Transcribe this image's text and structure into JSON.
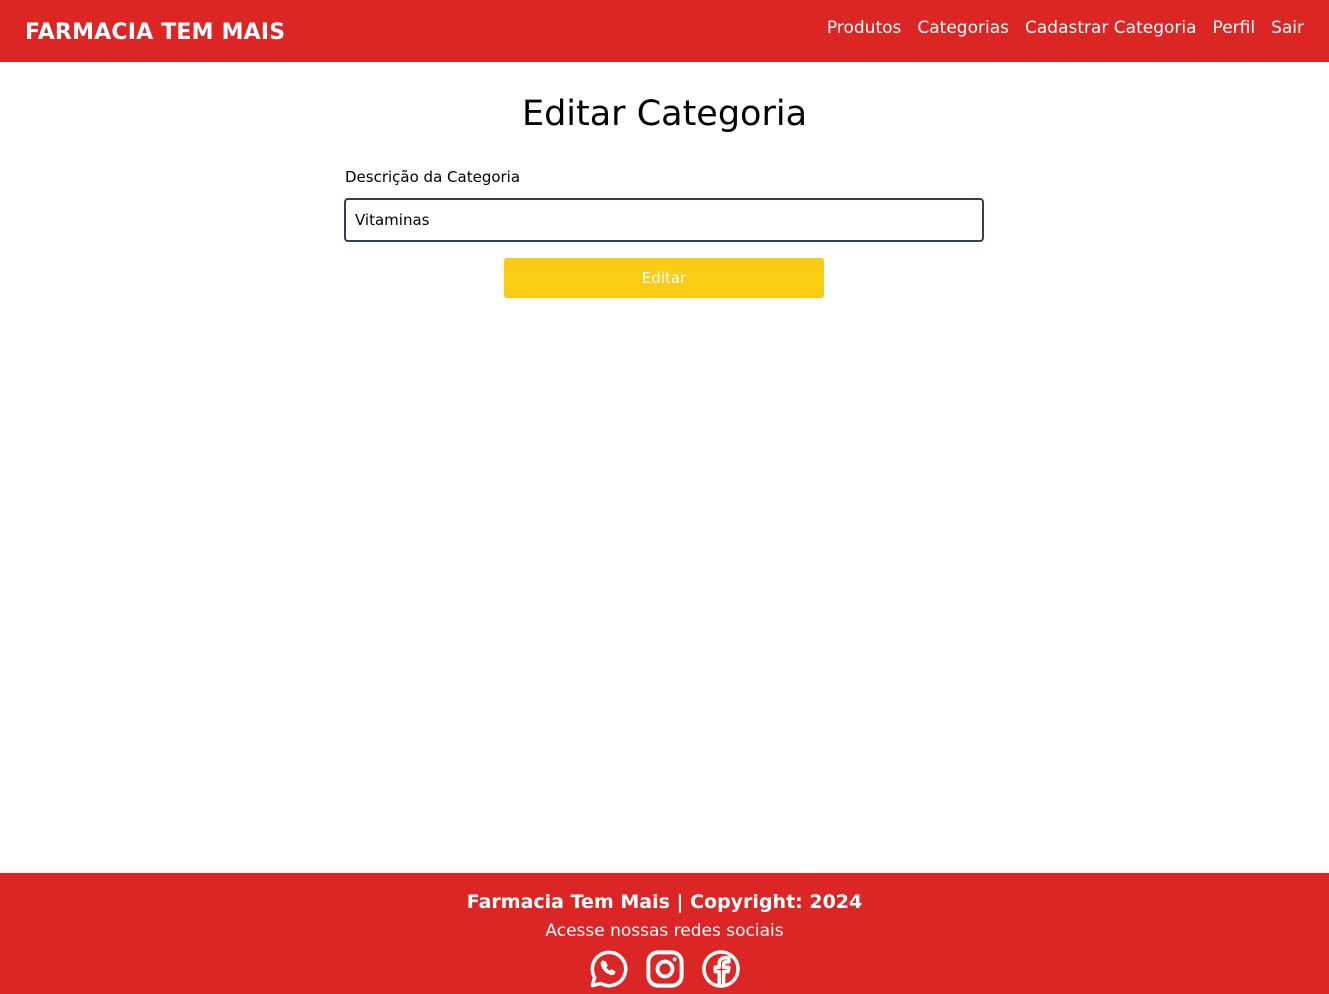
{
  "header": {
    "brand": "FARMACIA TEM MAIS",
    "nav": [
      {
        "label": "Produtos"
      },
      {
        "label": "Categorias"
      },
      {
        "label": "Cadastrar Categoria"
      },
      {
        "label": "Perfil"
      },
      {
        "label": "Sair"
      }
    ]
  },
  "form": {
    "title": "Editar Categoria",
    "field_label": "Descrição da Categoria",
    "field_value": "Vitaminas",
    "submit_label": "Editar"
  },
  "footer": {
    "title": "Farmacia Tem Mais | Copyright: 2024",
    "subtitle": "Acesse nossas redes sociais",
    "socials": [
      "whatsapp-icon",
      "instagram-icon",
      "facebook-icon"
    ]
  },
  "colors": {
    "primary": "#dc2626",
    "button": "#facc15",
    "input_border": "#334155"
  }
}
